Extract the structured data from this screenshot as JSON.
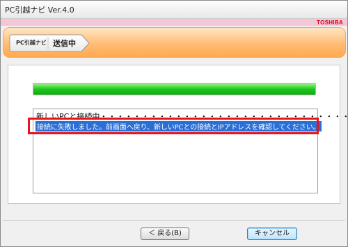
{
  "window": {
    "title": "PC引越ナビ Ver.4.0",
    "brand": "TOSHIBA"
  },
  "header": {
    "app_badge": "PC引越ナビ",
    "step_title": "送信中"
  },
  "progress": {
    "value_fraction": 1.0
  },
  "log": {
    "line1_text": "新しいPCと接続中",
    "line1_dots": "・・・・・・・・・・・・・・・・・・・・・・・・・・・・・・",
    "line2_error": "接続に失敗しました。前画面へ戻り、新しいPCとの接続とIPアドレスを確認してください。"
  },
  "buttons": {
    "back_label": "＜ 戻る(B)",
    "cancel_label": "キャンセル"
  },
  "colors": {
    "brand_red": "#e0001a",
    "header_orange": "#ffa94f",
    "progress_green": "#1ec81e",
    "selection_blue": "#2a6fd6",
    "highlight_red": "#e8141c"
  }
}
